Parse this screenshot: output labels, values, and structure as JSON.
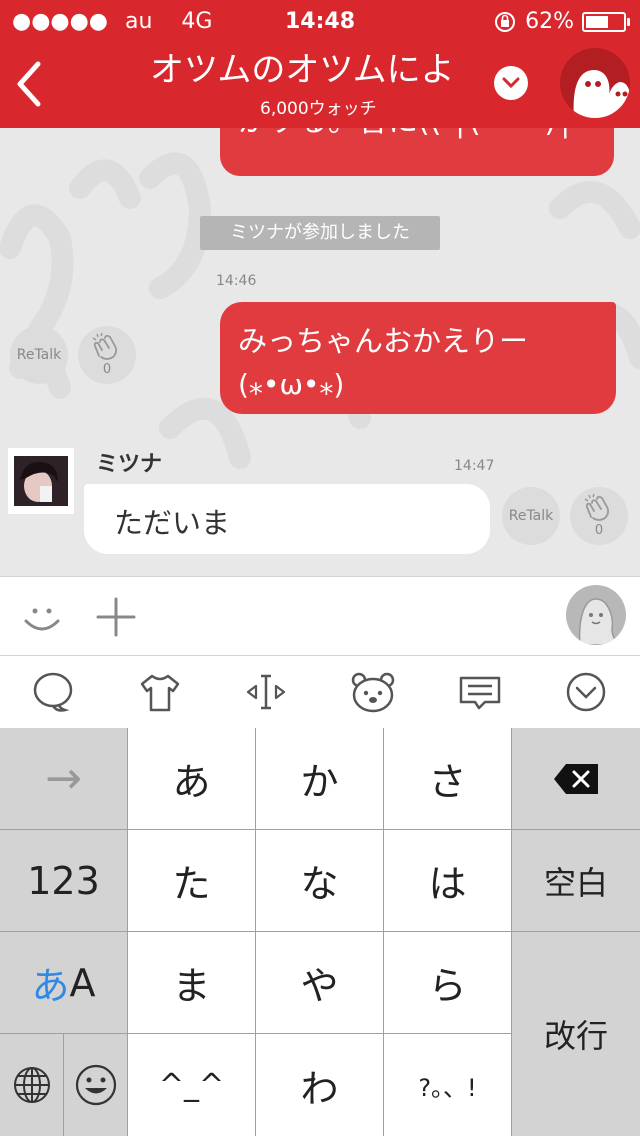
{
  "status_bar": {
    "signal_dots": "●●●●●",
    "carrier": "au",
    "network": "4G",
    "time": "14:48",
    "battery_percent": "62%",
    "battery_level": 0.62
  },
  "header": {
    "title": "オツムのオツムによ",
    "subtitle": "6,000ウォッチ",
    "accent_color": "#d9282d"
  },
  "chat": {
    "previous_message": "がする。昔に(( ╮(╹ㅂ╹)╭ ”",
    "system_notice": "ミツナが参加しました",
    "messages": [
      {
        "time": "14:46",
        "text_line1": "みっちゃんおかえりー",
        "text_line2": "(⁎•ω•⁎)",
        "retalk_label": "ReTalk",
        "clap_count": "0"
      },
      {
        "sender": "ミツナ",
        "time": "14:47",
        "text": "ただいま",
        "retalk_label": "ReTalk",
        "clap_count": "0"
      }
    ]
  },
  "input_bar": {
    "icons": [
      "smile-icon",
      "plus-icon",
      "voice-avatar-icon"
    ]
  },
  "toolbar": {
    "icons": [
      "speech-bubble-icon",
      "tshirt-icon",
      "cursor-icon",
      "bear-face-icon",
      "message-icon",
      "chevron-down-icon"
    ]
  },
  "keyboard": {
    "row1": [
      "あ",
      "か",
      "さ"
    ],
    "row2": [
      "た",
      "な",
      "は"
    ],
    "row3": [
      "ま",
      "や",
      "ら"
    ],
    "row4": [
      "^_^",
      "わ",
      "?。、!"
    ],
    "left_keys": {
      "arrow": "→",
      "numbers": "123",
      "kana_a": "あ",
      "kana_A": "A"
    },
    "right_keys": {
      "backspace": "⌫",
      "space": "空白",
      "enter": "改行"
    }
  }
}
